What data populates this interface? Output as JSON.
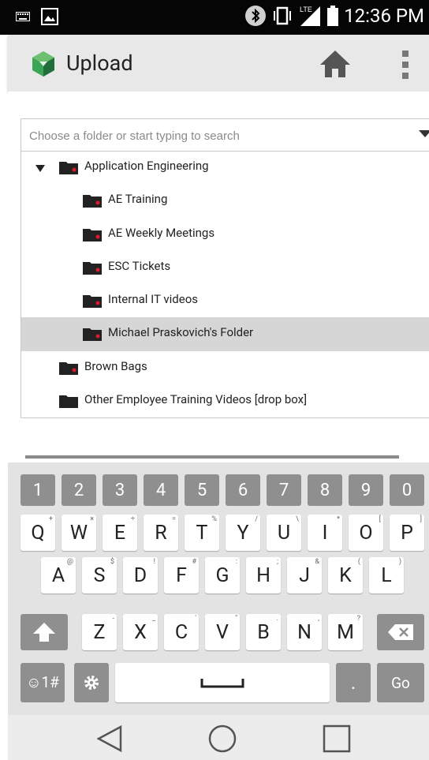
{
  "status_bar": {
    "time": "12:36 PM",
    "network": "LTE"
  },
  "app_bar": {
    "title": "Upload"
  },
  "search": {
    "placeholder": "Choose a folder or start typing to search",
    "value": ""
  },
  "tree": {
    "items": [
      {
        "label": "Application Engineering",
        "level": 0,
        "expanded": true,
        "selected": false
      },
      {
        "label": "AE Training",
        "level": 1,
        "selected": false
      },
      {
        "label": "AE Weekly Meetings",
        "level": 1,
        "selected": false
      },
      {
        "label": "ESC Tickets",
        "level": 1,
        "selected": false
      },
      {
        "label": "Internal IT videos",
        "level": 1,
        "selected": false
      },
      {
        "label": "Michael Praskovich's Folder",
        "level": 1,
        "selected": true
      },
      {
        "label": "Brown Bags",
        "level": 0,
        "selected": false
      },
      {
        "label": "Other Employee Training Videos [drop box]",
        "level": 0,
        "selected": false
      }
    ]
  },
  "keyboard": {
    "numbers": [
      "1",
      "2",
      "3",
      "4",
      "5",
      "6",
      "7",
      "8",
      "9",
      "0"
    ],
    "row1": [
      {
        "key": "Q",
        "alt": "+"
      },
      {
        "key": "W",
        "alt": "×"
      },
      {
        "key": "E",
        "alt": "÷"
      },
      {
        "key": "R",
        "alt": "="
      },
      {
        "key": "T",
        "alt": "%"
      },
      {
        "key": "Y",
        "alt": "/"
      },
      {
        "key": "U",
        "alt": "\\"
      },
      {
        "key": "I",
        "alt": "*"
      },
      {
        "key": "O",
        "alt": "["
      },
      {
        "key": "P",
        "alt": "]"
      }
    ],
    "row2": [
      {
        "key": "A",
        "alt": "@"
      },
      {
        "key": "S",
        "alt": "$"
      },
      {
        "key": "D",
        "alt": "!"
      },
      {
        "key": "F",
        "alt": "#"
      },
      {
        "key": "G",
        "alt": ":"
      },
      {
        "key": "H",
        "alt": ";"
      },
      {
        "key": "J",
        "alt": "&"
      },
      {
        "key": "K",
        "alt": "("
      },
      {
        "key": "L",
        "alt": ")"
      }
    ],
    "row3": [
      {
        "key": "Z",
        "alt": "-"
      },
      {
        "key": "X",
        "alt": "_"
      },
      {
        "key": "C",
        "alt": "'"
      },
      {
        "key": "V",
        "alt": "\""
      },
      {
        "key": "B",
        "alt": "."
      },
      {
        "key": "N",
        "alt": ","
      },
      {
        "key": "M",
        "alt": "?"
      }
    ],
    "symbols_label": "☺1#",
    "period_label": ".",
    "go_label": "Go"
  },
  "colors": {
    "folder": "#222222",
    "folder_dot": "#e0182d",
    "logo_green": "#3aa655",
    "logo_dark": "#1f6e3c"
  }
}
